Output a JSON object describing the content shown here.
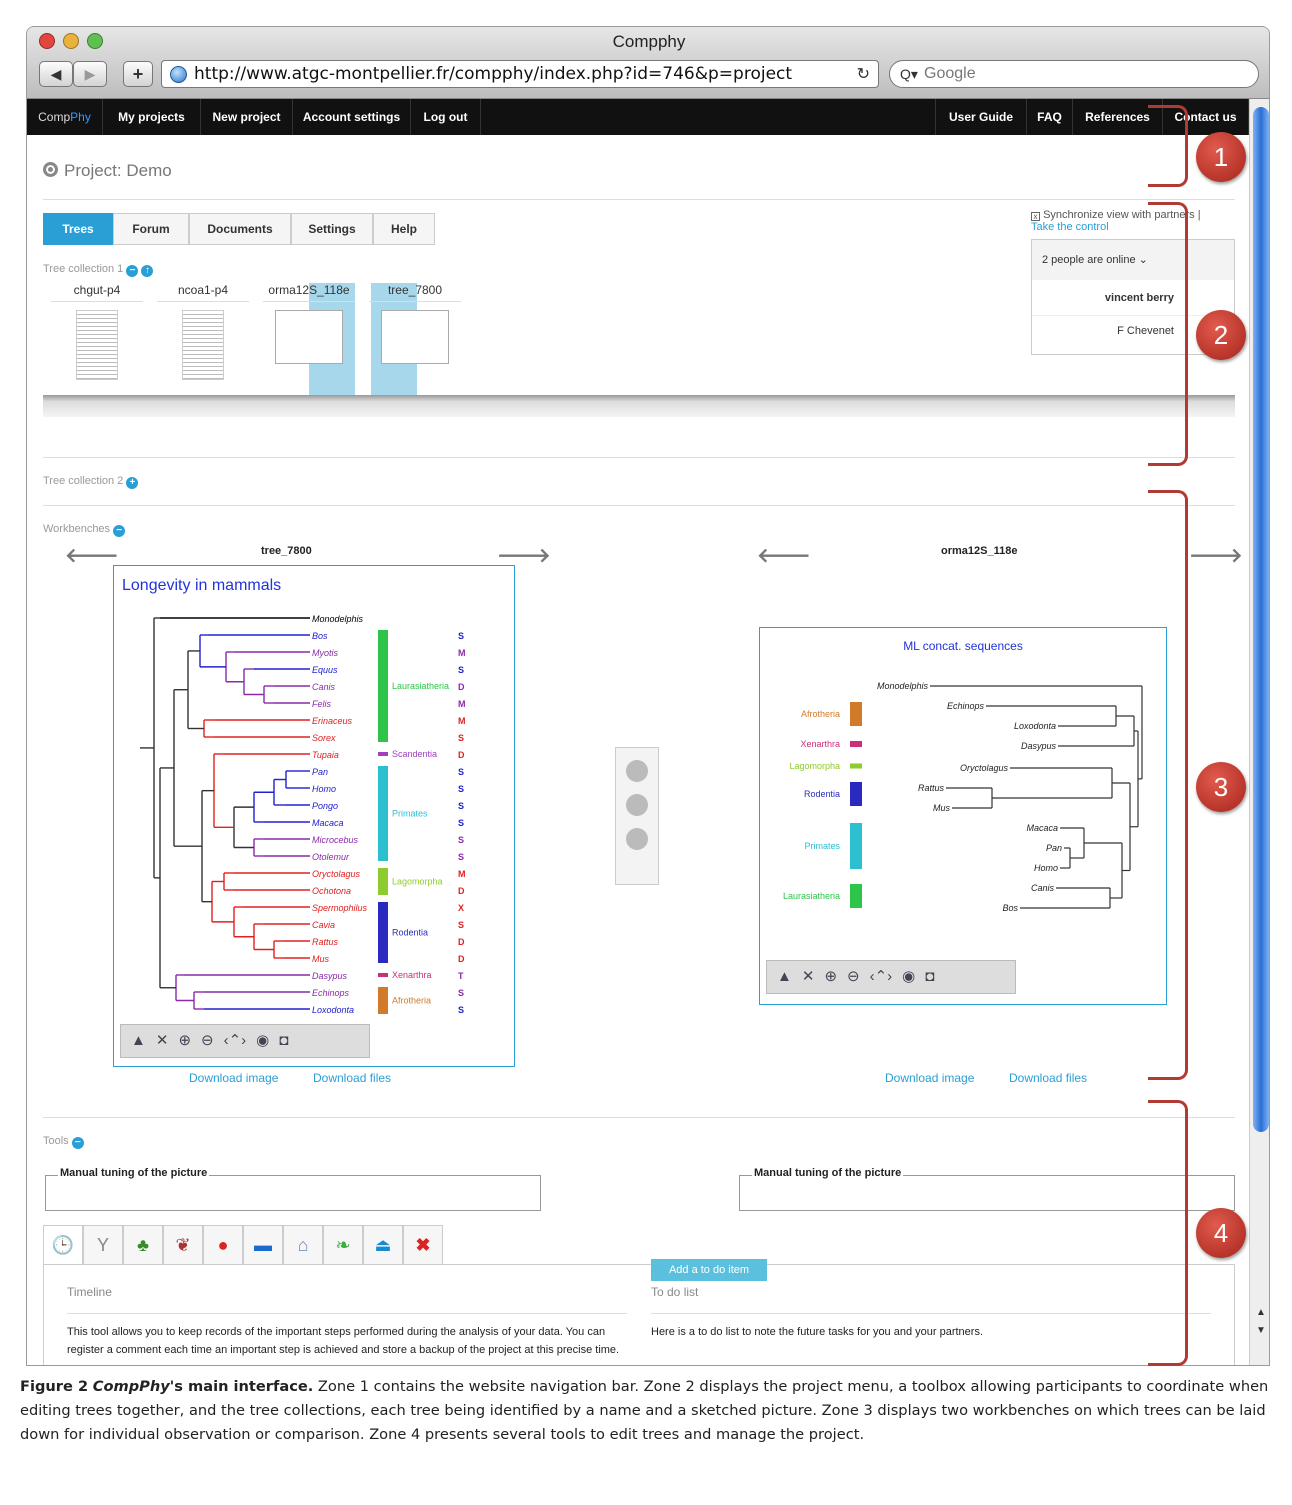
{
  "browser": {
    "title": "Compphy",
    "url": "http://www.atgc-montpellier.fr/compphy/index.php?id=746&p=project",
    "search_placeholder": "Google"
  },
  "nav": {
    "brand_a": "Comp",
    "brand_b": "Phy",
    "left_items": [
      "My projects",
      "New project",
      "Account settings",
      "Log out"
    ],
    "right_items": [
      "User Guide",
      "FAQ",
      "References",
      "Contact us"
    ]
  },
  "project": {
    "title": "Project: Demo",
    "tabs": [
      "Trees",
      "Forum",
      "Documents",
      "Settings",
      "Help"
    ],
    "collection1_label": "Tree collection 1",
    "collection2_label": "Tree collection 2",
    "trees": [
      "chgut-p4",
      "ncoa1-p4",
      "orma12S_118e",
      "tree_7800"
    ]
  },
  "sync": {
    "label": "Synchronize view with partners |",
    "take_control": "Take the control",
    "online": "2 people are online",
    "user1": "vincent berry",
    "user2": "F Chevenet"
  },
  "workbench": {
    "label": "Workbenches",
    "left_title": "tree_7800",
    "right_title": "orma12S_118e",
    "left_plot_title": "Longevity in mammals",
    "right_plot_title": "ML concat. sequences",
    "download_image": "Download image",
    "download_files": "Download files",
    "left_taxa": [
      {
        "name": "Monodelphis",
        "color": "#000"
      },
      {
        "name": "Bos",
        "color": "#2020d0"
      },
      {
        "name": "Myotis",
        "color": "#8a2aa8"
      },
      {
        "name": "Equus",
        "color": "#2020d0"
      },
      {
        "name": "Canis",
        "color": "#8a2aa8"
      },
      {
        "name": "Felis",
        "color": "#8a2aa8"
      },
      {
        "name": "Erinaceus",
        "color": "#e02020"
      },
      {
        "name": "Sorex",
        "color": "#e02020"
      },
      {
        "name": "Tupaia",
        "color": "#e02020"
      },
      {
        "name": "Pan",
        "color": "#2020d0"
      },
      {
        "name": "Homo",
        "color": "#2020d0"
      },
      {
        "name": "Pongo",
        "color": "#2020d0"
      },
      {
        "name": "Macaca",
        "color": "#2020d0"
      },
      {
        "name": "Microcebus",
        "color": "#8a2aa8"
      },
      {
        "name": "Otolemur",
        "color": "#8a2aa8"
      },
      {
        "name": "Oryctolagus",
        "color": "#e02020"
      },
      {
        "name": "Ochotona",
        "color": "#e02020"
      },
      {
        "name": "Spermophilus",
        "color": "#e02020"
      },
      {
        "name": "Cavia",
        "color": "#e02020"
      },
      {
        "name": "Rattus",
        "color": "#e02020"
      },
      {
        "name": "Mus",
        "color": "#e02020"
      },
      {
        "name": "Dasypus",
        "color": "#8a2aa8"
      },
      {
        "name": "Echinops",
        "color": "#8a2aa8"
      },
      {
        "name": "Loxodonta",
        "color": "#2020d0"
      }
    ],
    "left_codes": [
      "",
      "S",
      "M",
      "S",
      "D",
      "M",
      "M",
      "S",
      "D",
      "S",
      "S",
      "S",
      "S",
      "S",
      "S",
      "M",
      "D",
      "X",
      "S",
      "D",
      "D",
      "T",
      "S",
      "S"
    ],
    "left_groups": [
      {
        "name": "Laurasiatheria",
        "color": "#2ec44a",
        "from": 1,
        "to": 7
      },
      {
        "name": "Scandentia",
        "color": "#a040c0",
        "from": 8,
        "to": 8
      },
      {
        "name": "Primates",
        "color": "#2bbfd0",
        "from": 9,
        "to": 14
      },
      {
        "name": "Lagomorpha",
        "color": "#8ecb2e",
        "from": 15,
        "to": 16
      },
      {
        "name": "Rodentia",
        "color": "#2a2ac0",
        "from": 17,
        "to": 20
      },
      {
        "name": "Xenarthra",
        "color": "#c8307a",
        "from": 21,
        "to": 21
      },
      {
        "name": "Afrotheria",
        "color": "#d07a2a",
        "from": 22,
        "to": 23
      }
    ],
    "right_taxa": [
      "Monodelphis",
      "Echinops",
      "Loxodonta",
      "Dasypus",
      "Oryctolagus",
      "Rattus",
      "Mus",
      "Macaca",
      "Pan",
      "Homo",
      "Canis",
      "Bos"
    ],
    "right_groups": [
      {
        "name": "Afrotheria",
        "color": "#d07a2a"
      },
      {
        "name": "Xenarthra",
        "color": "#c8307a"
      },
      {
        "name": "Lagomorpha",
        "color": "#8ecb2e"
      },
      {
        "name": "Rodentia",
        "color": "#2a2ac0"
      },
      {
        "name": "Primates",
        "color": "#2bbfd0"
      },
      {
        "name": "Laurasiatheria",
        "color": "#2ec44a"
      }
    ]
  },
  "tools": {
    "label": "Tools",
    "manual_tuning": "Manual tuning of the picture",
    "timeline_title": "Timeline",
    "timeline_text": "This tool allows you to keep records of the important steps performed during the analysis of your data. You can register a comment each time an important step is achieved and store a backup of the project at this precise time.",
    "todo_title": "To do list",
    "todo_text": "Here is a to do list to note the future tasks for you and your partners.",
    "todo_button": "Add a to do item"
  },
  "zones": [
    "1",
    "2",
    "3",
    "4"
  ],
  "caption": {
    "fig": "Figure 2",
    "app": "CompPhy",
    "lead": "'s main interface.",
    "body": " Zone 1 contains the website navigation bar. Zone 2 displays the project menu, a toolbox allowing participants to coordinate when editing trees together, and the tree collections, each tree being identified by a name and a sketched picture. Zone 3 displays two workbenches on which trees can be laid down for individual observation or comparison. Zone 4 presents several tools to edit trees and manage the project."
  }
}
